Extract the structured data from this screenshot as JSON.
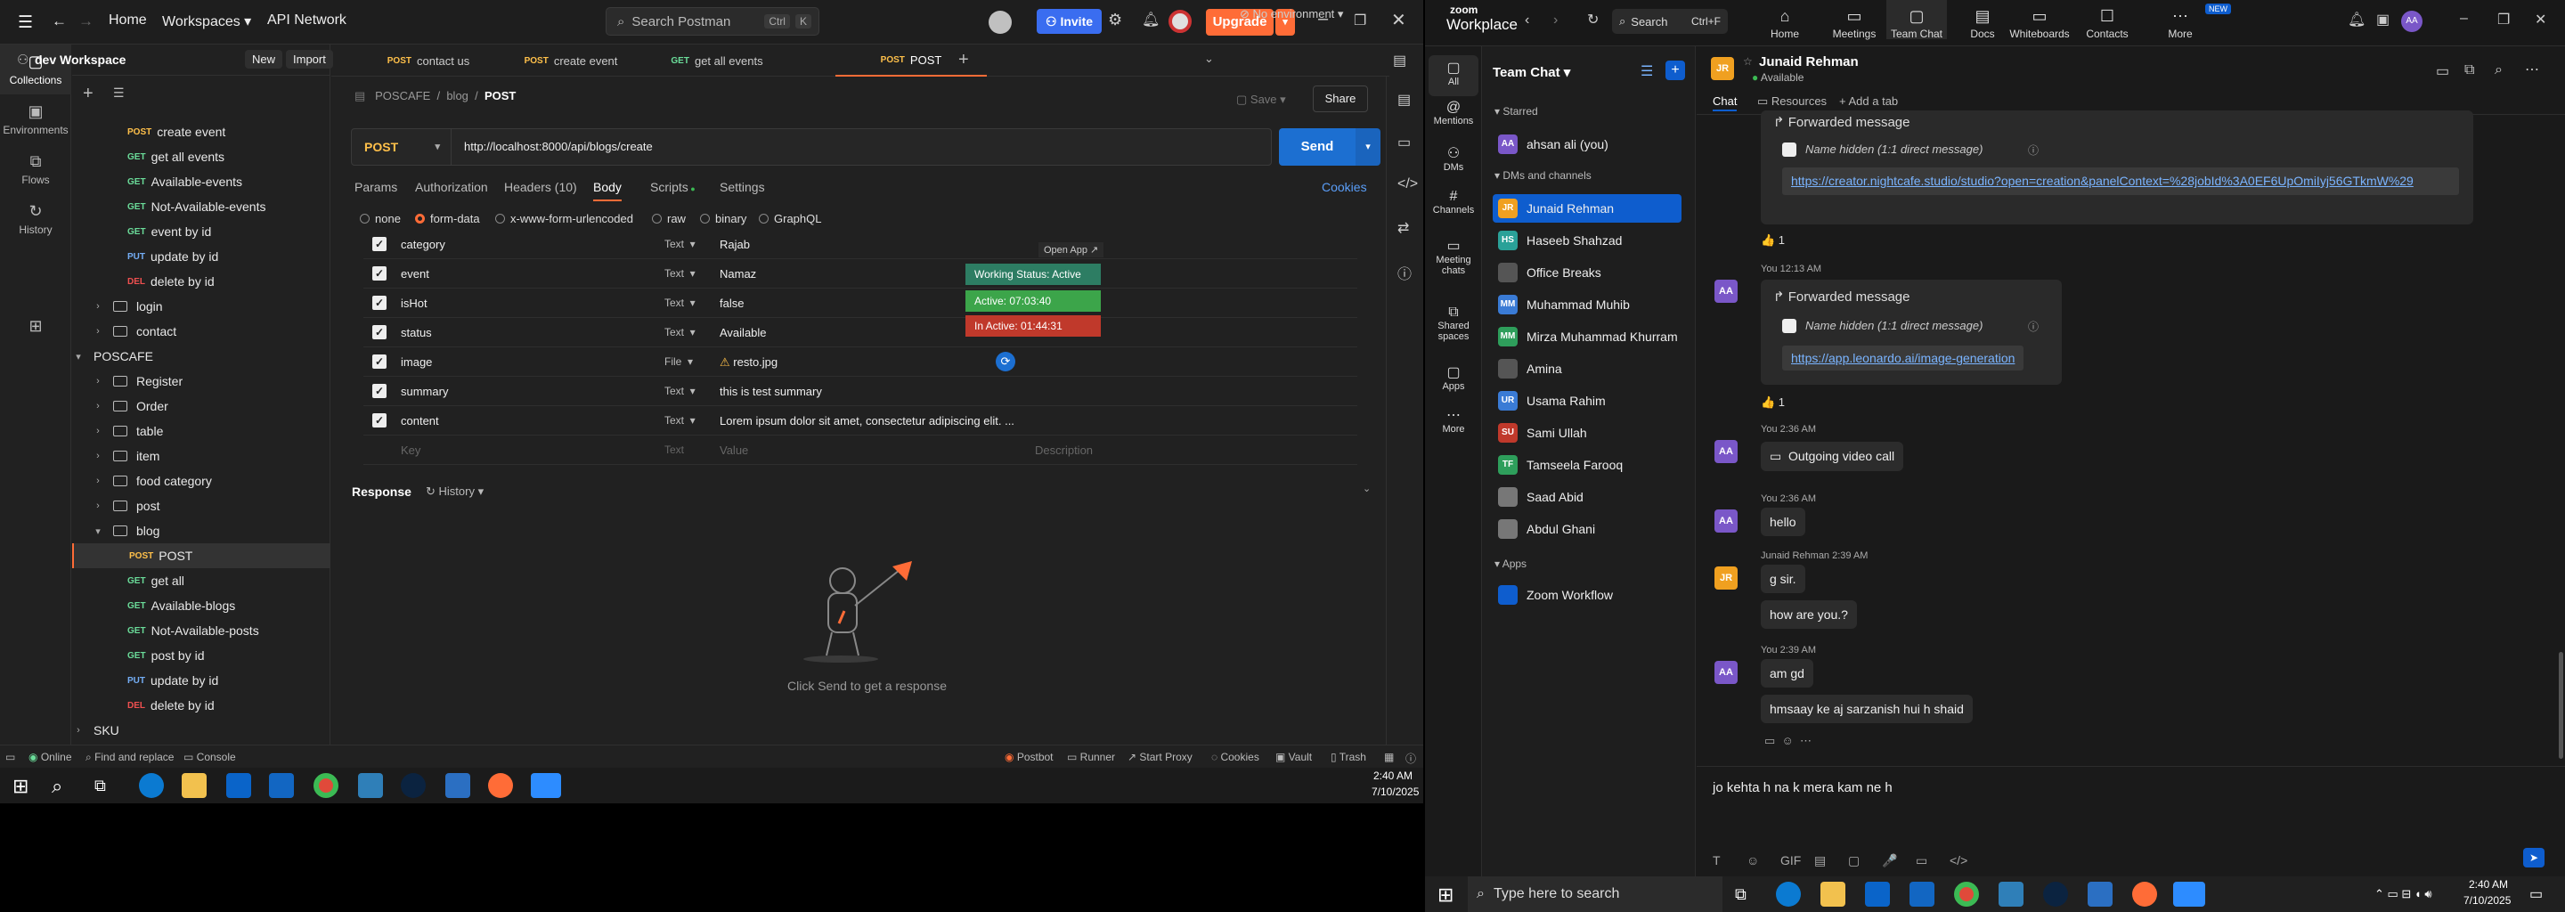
{
  "postman": {
    "nav": {
      "home": "Home",
      "workspaces": "Workspaces",
      "api_network": "API Network"
    },
    "search": {
      "placeholder": "Search Postman",
      "shortcut1": "Ctrl",
      "shortcut2": "K"
    },
    "invite": "Invite",
    "upgrade": "Upgrade",
    "workspace_name": "dev Workspace",
    "new_btn": "New",
    "import_btn": "Import",
    "rail": [
      {
        "label": "Collections",
        "icon": "collections-icon",
        "glyph": "▢"
      },
      {
        "label": "Environments",
        "icon": "environments-icon",
        "glyph": "▣"
      },
      {
        "label": "Flows",
        "icon": "flows-icon",
        "glyph": "⧉"
      },
      {
        "label": "History",
        "icon": "history-icon",
        "glyph": "↻"
      },
      {
        "label": "",
        "icon": "apps-icon",
        "glyph": "⊞"
      }
    ],
    "tree": [
      {
        "type": "req",
        "method": "POST",
        "cls": "post",
        "label": "create event",
        "indent": 1
      },
      {
        "type": "req",
        "method": "GET",
        "cls": "get",
        "label": "get all events",
        "indent": 1
      },
      {
        "type": "req",
        "method": "GET",
        "cls": "get",
        "label": "Available-events",
        "indent": 1
      },
      {
        "type": "req",
        "method": "GET",
        "cls": "get",
        "label": "Not-Available-events",
        "indent": 1
      },
      {
        "type": "req",
        "method": "GET",
        "cls": "get",
        "label": "event by id",
        "indent": 1
      },
      {
        "type": "req",
        "method": "PUT",
        "cls": "put",
        "label": "update by id",
        "indent": 1
      },
      {
        "type": "req",
        "method": "DEL",
        "cls": "del",
        "label": "delete by id",
        "indent": 1
      },
      {
        "type": "folder",
        "label": "login",
        "open": false,
        "indent": 0
      },
      {
        "type": "folder",
        "label": "contact",
        "open": false,
        "indent": 0
      },
      {
        "type": "coll",
        "label": "POSCAFE",
        "open": true
      },
      {
        "type": "folder",
        "label": "Register",
        "open": false,
        "indent": 0
      },
      {
        "type": "folder",
        "label": "Order",
        "open": false,
        "indent": 0
      },
      {
        "type": "folder",
        "label": "table",
        "open": false,
        "indent": 0
      },
      {
        "type": "folder",
        "label": "item",
        "open": false,
        "indent": 0
      },
      {
        "type": "folder",
        "label": "food category",
        "open": false,
        "indent": 0
      },
      {
        "type": "folder",
        "label": "post",
        "open": false,
        "indent": 0
      },
      {
        "type": "folder",
        "label": "blog",
        "open": true,
        "indent": 0
      },
      {
        "type": "req",
        "method": "POST",
        "cls": "post",
        "label": "POST",
        "indent": 1,
        "selected": true
      },
      {
        "type": "req",
        "method": "GET",
        "cls": "get",
        "label": "get all",
        "indent": 1
      },
      {
        "type": "req",
        "method": "GET",
        "cls": "get",
        "label": "Available-blogs",
        "indent": 1
      },
      {
        "type": "req",
        "method": "GET",
        "cls": "get",
        "label": "Not-Available-posts",
        "indent": 1
      },
      {
        "type": "req",
        "method": "GET",
        "cls": "get",
        "label": "post by id",
        "indent": 1
      },
      {
        "type": "req",
        "method": "PUT",
        "cls": "put",
        "label": "update by id",
        "indent": 1
      },
      {
        "type": "req",
        "method": "DEL",
        "cls": "del",
        "label": "delete by id",
        "indent": 1
      },
      {
        "type": "coll",
        "label": "SKU",
        "open": false
      }
    ],
    "tabs": [
      {
        "method": "POST",
        "cls": "post",
        "label": "contact us"
      },
      {
        "method": "POST",
        "cls": "post",
        "label": "create event"
      },
      {
        "method": "GET",
        "cls": "get",
        "label": "get all events"
      },
      {
        "method": "POST",
        "cls": "post",
        "label": "POST",
        "active": true
      }
    ],
    "environment": "No environment",
    "breadcrumb": {
      "a": "POSCAFE",
      "b": "blog",
      "c": "POST"
    },
    "save": "Save",
    "share": "Share",
    "method": "POST",
    "url": "http://localhost:8000/api/blogs/create",
    "send": "Send",
    "req_tabs": [
      "Params",
      "Authorization",
      "Headers (10)",
      "Body",
      "Scripts",
      "Settings"
    ],
    "cookies": "Cookies",
    "body_types": [
      "none",
      "form-data",
      "x-www-form-urlencoded",
      "raw",
      "binary",
      "GraphQL"
    ],
    "open_app": "Open App ↗",
    "form": [
      {
        "key": "category",
        "type": "Text",
        "value": "Rajab"
      },
      {
        "key": "event",
        "type": "Text",
        "value": "Namaz"
      },
      {
        "key": "isHot",
        "type": "Text",
        "value": "false"
      },
      {
        "key": "status",
        "type": "Text",
        "value": "Available"
      },
      {
        "key": "image",
        "type": "File",
        "value": "resto.jpg"
      },
      {
        "key": "summary",
        "type": "Text",
        "value": "this is test summary"
      },
      {
        "key": "content",
        "type": "Text",
        "value": "Lorem ipsum dolor sit amet, consectetur adipiscing elit. ..."
      }
    ],
    "new_row": {
      "key": "Key",
      "type": "Text",
      "value": "Value",
      "description": "Description"
    },
    "overlay": {
      "working": "Working Status: Active",
      "active": "Active: 07:03:40",
      "inactive": "In Active: 01:44:31"
    },
    "response_label": "Response",
    "history_label": "History",
    "no_response": "Click Send to get a response",
    "status_bar": {
      "online": "Online",
      "find": "Find and replace",
      "console": "Console",
      "postbot": "Postbot",
      "runner": "Runner",
      "proxy": "Start Proxy",
      "cookies": "Cookies",
      "vault": "Vault",
      "trash": "Trash"
    },
    "colors": {
      "accent": "#ff6c37",
      "send": "#1c6fd1"
    }
  },
  "left_taskbar": {
    "time": "2:40 AM",
    "date": "7/10/2025"
  },
  "zoom": {
    "brand_top": "zoom",
    "brand": "Workplace",
    "search": "Search",
    "search_shortcut": "Ctrl+F",
    "nav": [
      {
        "label": "Home",
        "icon": "home-icon",
        "glyph": "⌂"
      },
      {
        "label": "Meetings",
        "icon": "meetings-icon",
        "glyph": "▭"
      },
      {
        "label": "Team Chat",
        "icon": "team-chat-icon",
        "glyph": "▢",
        "active": true
      },
      {
        "label": "Docs",
        "icon": "docs-icon",
        "glyph": "▤"
      },
      {
        "label": "Whiteboards",
        "icon": "whiteboards-icon",
        "glyph": "▭"
      },
      {
        "label": "Contacts",
        "icon": "contacts-icon",
        "glyph": "☐"
      },
      {
        "label": "More",
        "icon": "more-icon",
        "glyph": "⋯"
      }
    ],
    "new_badge": "NEW",
    "rail": [
      {
        "label": "All",
        "glyph": "▢"
      },
      {
        "label": "Mentions",
        "glyph": "@"
      },
      {
        "label": "DMs",
        "glyph": "⚇"
      },
      {
        "label": "Channels",
        "glyph": "#"
      },
      {
        "label": "Meeting chats",
        "glyph": "▭"
      },
      {
        "label": "Shared spaces",
        "glyph": "⧉"
      },
      {
        "label": "Apps",
        "glyph": "▢"
      },
      {
        "label": "More",
        "glyph": "⋯"
      }
    ],
    "list_title": "Team Chat",
    "starred": "Starred",
    "starred_items": [
      {
        "label": "ahsan ali (you)",
        "av": "AA",
        "color": "#7a57c8"
      }
    ],
    "dms_label": "DMs and channels",
    "dms": [
      {
        "label": "Junaid Rehman",
        "av": "JR",
        "color": "#f0a020",
        "selected": true
      },
      {
        "label": "Haseeb Shahzad",
        "av": "HS",
        "color": "#2aa198"
      },
      {
        "label": "Office Breaks",
        "av": "",
        "color": "#555"
      },
      {
        "label": "Muhammad Muhib",
        "av": "MM",
        "color": "#3a7bd5"
      },
      {
        "label": "Mirza Muhammad Khurram",
        "av": "MM",
        "color": "#2e9e5b"
      },
      {
        "label": "Amina",
        "av": "",
        "color": "#555"
      },
      {
        "label": "Usama Rahim",
        "av": "UR",
        "color": "#3a7bd5"
      },
      {
        "label": "Sami Ullah",
        "av": "SU",
        "color": "#c0392b"
      },
      {
        "label": "Tamseela Farooq",
        "av": "TF",
        "color": "#2e9e5b"
      },
      {
        "label": "Saad Abid",
        "av": "",
        "color": "#777"
      },
      {
        "label": "Abdul Ghani",
        "av": "",
        "color": "#777"
      }
    ],
    "apps_label": "Apps",
    "apps": [
      {
        "label": "Zoom Workflow",
        "av": "",
        "color": "#0e5dce"
      }
    ],
    "chat_header": {
      "name": "Junaid Rehman",
      "status": "Available",
      "tabs": [
        "Chat",
        "Resources",
        "Add a tab"
      ]
    },
    "messages": {
      "fwd1_label": "Forwarded message",
      "fwd1_sub": "Name hidden (1:1 direct message)",
      "fwd1_link": "https://creator.nightcafe.studio/studio?open=creation&panelContext=%28jobId%3A0EF6UpOmiIyj56GTkmW%29",
      "react1": "👍 1",
      "meta2": "You 12:13 AM",
      "fwd2_label": "Forwarded message",
      "fwd2_sub": "Name hidden (1:1 direct message)",
      "fwd2_link": "https://app.leonardo.ai/image-generation",
      "react2": "👍 1",
      "meta3": "You 2:36 AM",
      "call": "Outgoing video call",
      "meta4": "You 2:36 AM",
      "m4": "hello",
      "meta5": "Junaid Rehman 2:39 AM",
      "m5a": "g sir.",
      "m5b": "how are you.?",
      "meta6": "You 2:39 AM",
      "m6a": "am gd",
      "m6b": "hmsaay ke aj sarzanish hui h shaid"
    },
    "composer": "jo kehta h na k mera kam ne h",
    "composer_tools": [
      "T",
      "☺",
      "GIF",
      "▤",
      "▢",
      "🎤",
      "▭",
      "</>"
    ]
  },
  "right_taskbar": {
    "search_placeholder": "Type here to search",
    "time": "2:40 AM",
    "date": "7/10/2025"
  }
}
